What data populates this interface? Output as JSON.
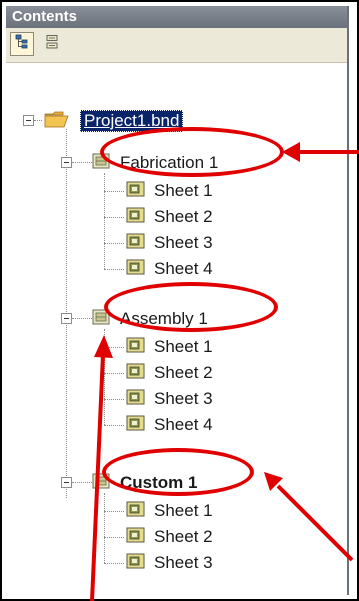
{
  "panel": {
    "title": "Contents"
  },
  "toolbar": {
    "buttons": [
      {
        "icon": "tree-view-icon",
        "active": true
      },
      {
        "icon": "list-view-icon",
        "active": false
      }
    ]
  },
  "tree": {
    "root": {
      "label": "Project1.bnd",
      "icon": "folder-icon"
    },
    "groups": [
      {
        "label": "Fabrication 1",
        "bold": false,
        "sheets": [
          "Sheet 1",
          "Sheet 2",
          "Sheet 3",
          "Sheet 4"
        ]
      },
      {
        "label": "Assembly 1",
        "bold": false,
        "sheets": [
          "Sheet 1",
          "Sheet 2",
          "Sheet 3",
          "Sheet 4"
        ]
      },
      {
        "label": "Custom 1",
        "bold": true,
        "sheets": [
          "Sheet 1",
          "Sheet 2",
          "Sheet 3"
        ]
      }
    ]
  },
  "annotations": {
    "color": "#e00000"
  }
}
